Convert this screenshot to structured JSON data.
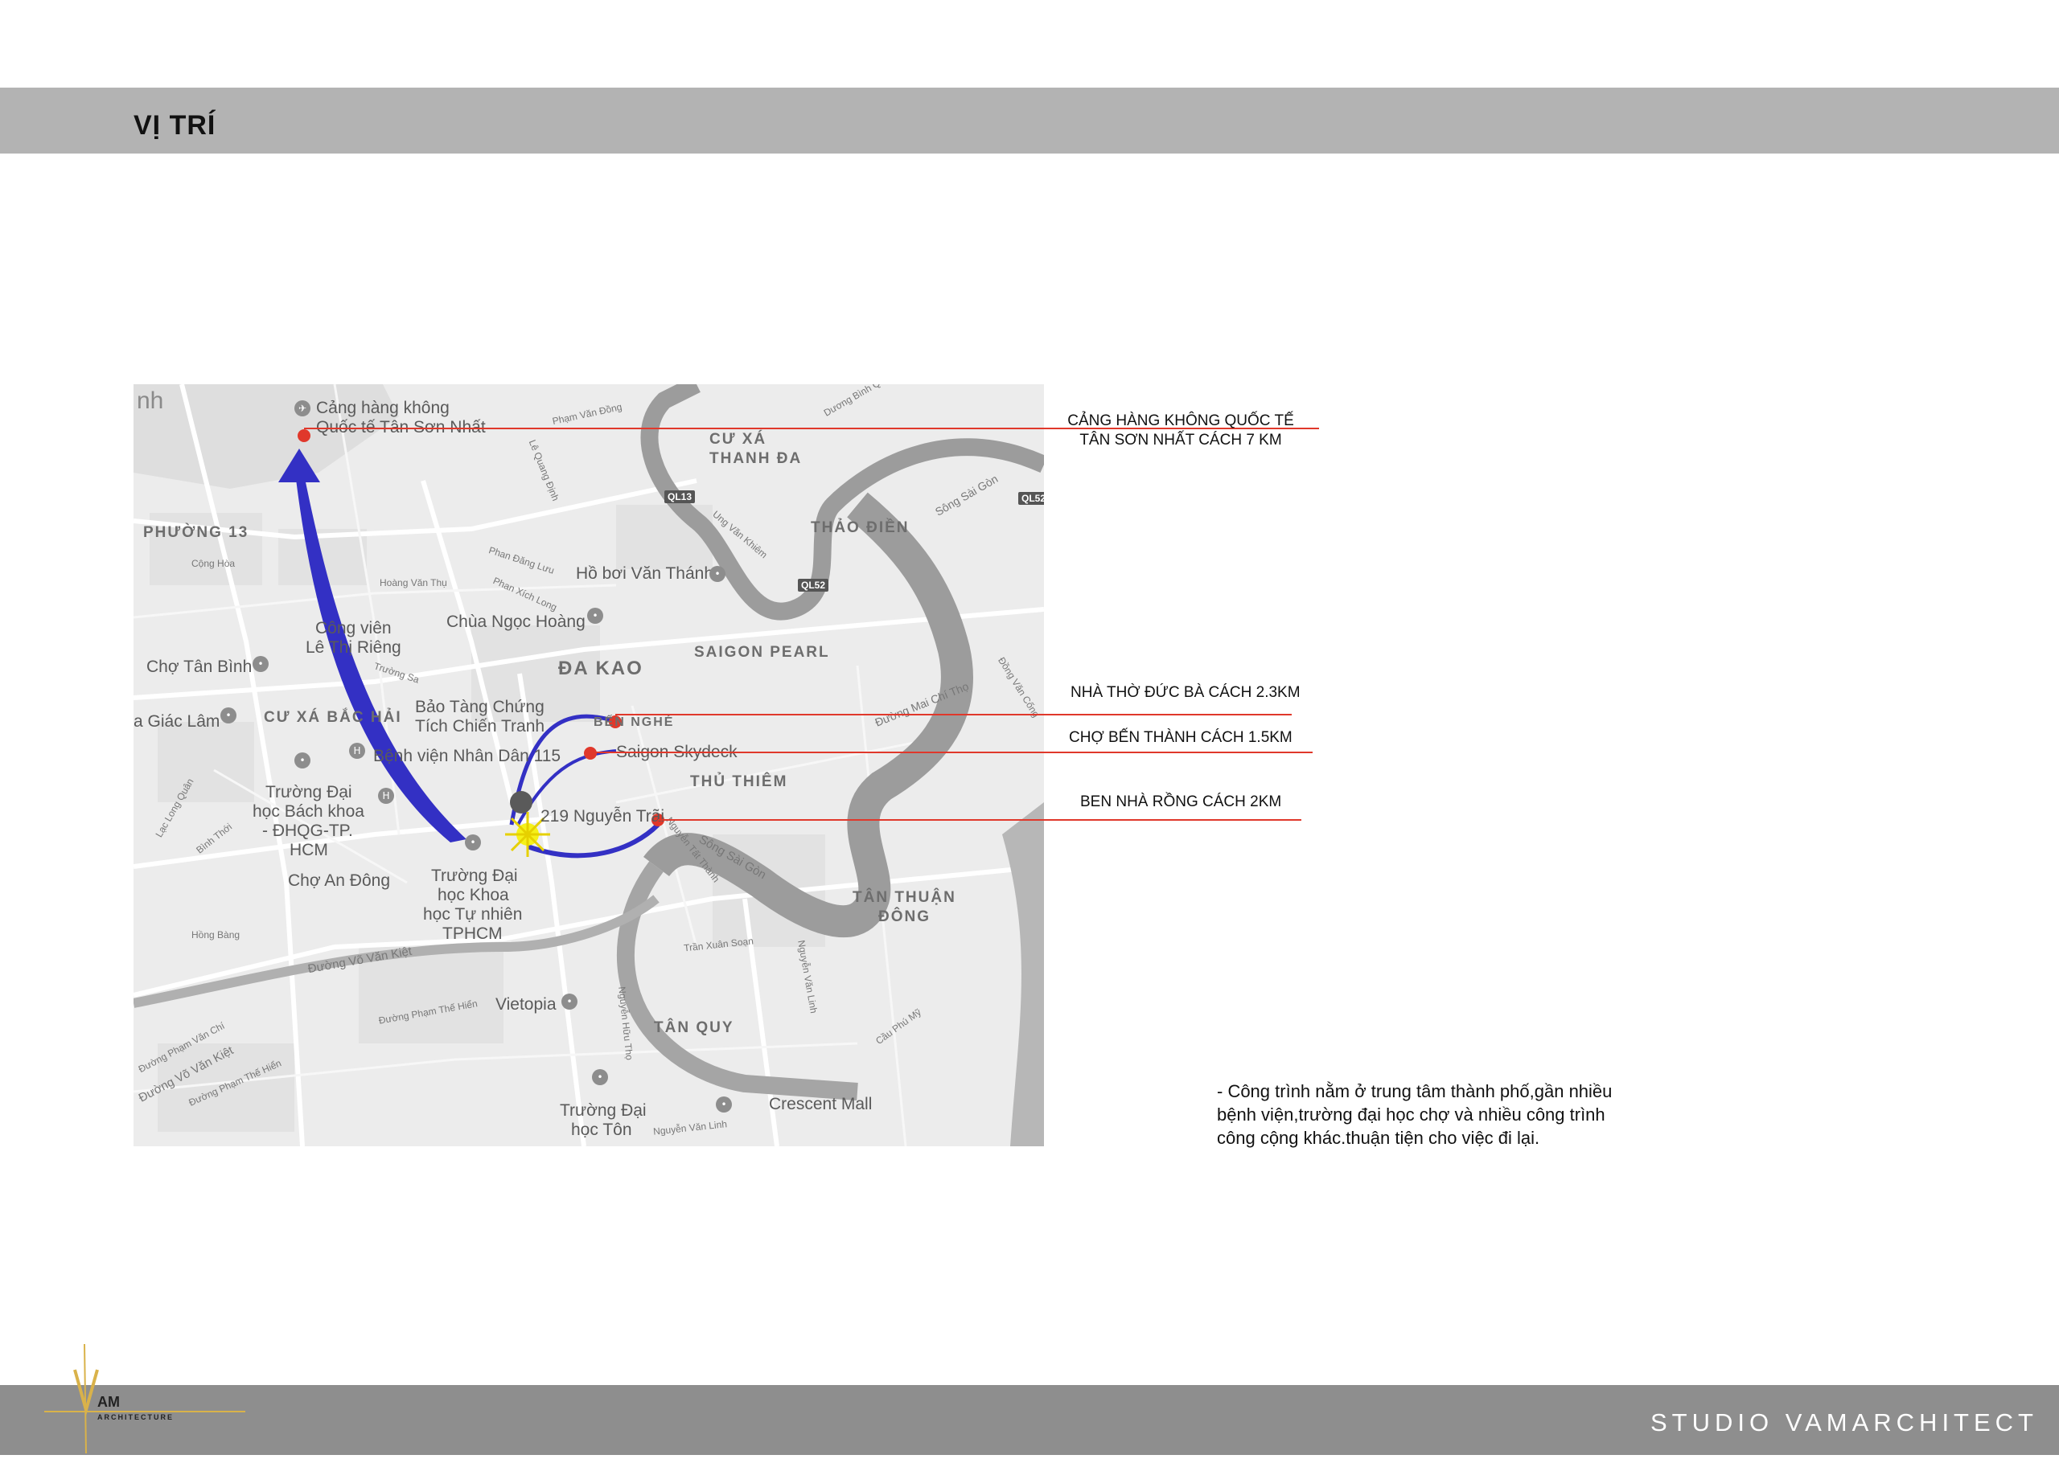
{
  "page": {
    "title": "VỊ TRÍ"
  },
  "map": {
    "districts": [
      "CƯ XÁ",
      "THANH ĐA",
      "THẢO ĐIỀN",
      "PHƯỜNG 13",
      "ĐA KAO",
      "SAIGON PEARL",
      "CƯ XÁ BẮC HẢI",
      "BẾN NGHÉ",
      "THỦ THIÊM",
      "TÂN THUẬN",
      "ĐÔNG",
      "TÂN QUY"
    ],
    "places": [
      "Cảng hàng không",
      "Quốc tế Tân Sơn Nhất",
      "Hồ bơi Văn Thánh",
      "Chùa Ngọc Hoàng",
      "Công viên",
      "Lê Thị Riêng",
      "Chợ Tân Bình",
      "Bảo Tàng Chứng",
      "Tích Chiến Tranh",
      "Bệnh viện Nhân Dân 115",
      "a Giác Lâm",
      "Trường Đại",
      "học Bách khoa",
      "- ĐHQG-TP.",
      "HCM",
      "Chợ An Đông",
      "Trường Đại",
      "học Khoa",
      "học Tự nhiên",
      "TPHCM",
      "Saigon Skydeck",
      "219 Nguyễn Trãi",
      "Vietopia",
      "Crescent Mall",
      "Trường Đại",
      "học Tôn",
      "nh"
    ],
    "streets": [
      "Phạm Văn Đồng",
      "Lê Quang Định",
      "Ung Văn Khiêm",
      "Sông Sài Gòn",
      "Cộng Hòa",
      "Hoàng Văn Thụ",
      "Phan Đăng Lưu",
      "Phan Xích Long",
      "Trường Sa",
      "Đường Mai Chí Thọ",
      "Đồng Văn Cống",
      "Lạc Long Quân",
      "Bình Thới",
      "Hồng Bàng",
      "Đường Võ Văn Kiệt",
      "Đường Phạm Văn Chí",
      "Đường Võ Văn Kiệt",
      "Đường Phạm Thế Hiển",
      "Đường Phạm Thế Hiển",
      "Trần Xuân Soạn",
      "Nguyễn Văn Linh",
      "Nguyễn Văn Linh",
      "Nguyễn Hữu Thọ",
      "Nguyễn Tất Thành",
      "Sông Sài Gòn",
      "Cầu Phú Mỹ",
      "Dương Bình Q"
    ],
    "shields": [
      "QL13",
      "QL52",
      "QL52"
    ],
    "origin_marker": "sun-icon",
    "accent_arrow_color": "#3330c4",
    "pin_color": "#e0382b",
    "leader_line_color": "#e0382b"
  },
  "callouts": {
    "airport_line1": "CẢNG HÀNG KHÔNG QUỐC TẾ",
    "airport_line2": "TÂN SƠN NHẤT CÁCH 7 KM",
    "cathedral": "NHÀ THỜ ĐỨC BÀ  CÁCH 2.3KM",
    "market": "CHỢ BẾN THÀNH CÁCH 1.5KM",
    "wharf": "BEN NHÀ RỒNG CÁCH 2KM"
  },
  "description": {
    "line1": "- Công trình nằm ở trung tâm thành phố,gần nhiều",
    "line2": "bệnh viện,trường đại học chợ và nhiều công trình",
    "line3": "công cộng khác.thuận tiện cho việc đi lại."
  },
  "footer": {
    "studio": "STUDIO VAMARCHITECT",
    "logo_text": "AM",
    "logo_subtext": "ARCHITECTURE"
  }
}
